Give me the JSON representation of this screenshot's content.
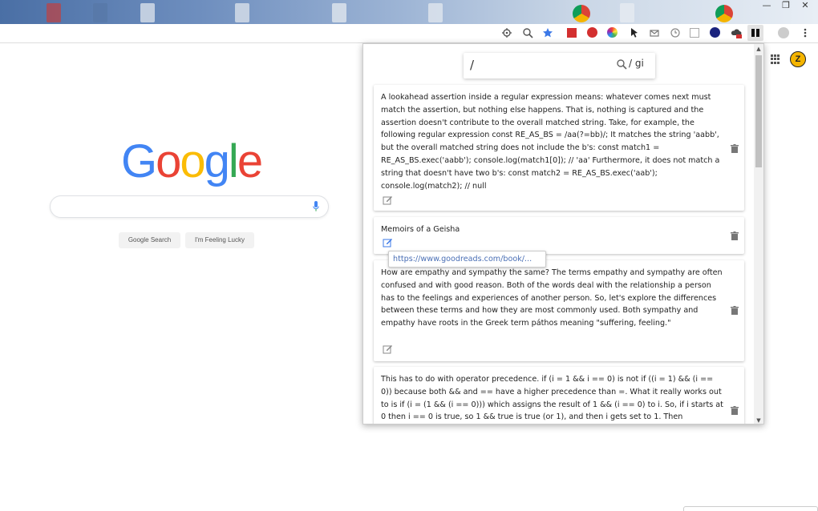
{
  "window": {
    "minimize": "—",
    "maximize": "❐",
    "close": "✕"
  },
  "google": {
    "logo_letters": [
      "G",
      "o",
      "o",
      "g",
      "l",
      "e"
    ],
    "logo_colors": [
      "#4285F4",
      "#EA4335",
      "#FBBC05",
      "#4285F4",
      "#34A853",
      "#EA4335"
    ],
    "search_button": "Google Search",
    "lucky_button": "I'm Feeling Lucky"
  },
  "popup": {
    "search_value": "/",
    "search_flags": "/ gi",
    "cards": [
      {
        "text": "A lookahead assertion inside a regular expression means: whatever comes next must match the assertion, but nothing else happens. That is, nothing is captured and the assertion doesn't contribute to the overall matched string. Take, for example, the following regular expression const RE_AS_BS = /aa(?=bb)/; It matches the string 'aabb', but the overall matched string does not include the b's: const match1 = RE_AS_BS.exec('aabb'); console.log(match1[0]); // 'aa' Furthermore, it does not match a string that doesn't have two b's: const match2 = RE_AS_BS.exec('aab'); console.log(match2); // null"
      },
      {
        "text": "Memoirs of a Geisha"
      },
      {
        "text": "How are empathy and sympathy the same? The terms empathy and sympathy are often confused and with good reason. Both of the words deal with the relationship a person has to the feelings and experiences of another person. So, let's explore the differences between these terms and how they are most commonly used. Both sympathy and empathy have roots in the Greek term páthos meaning \"suffering, feeling.\""
      },
      {
        "text": "This has to do with operator precedence. if (i = 1 && i == 0) is not if ((i = 1) && (i == 0)) because both && and == have a higher precedence than =. What it really works out to is if (i = (1 && (i == 0))) which assigns the result of 1 && (i == 0) to i. So, if i starts at 0 then i == 0 is true, so 1 && true is true (or 1), and then i gets set to 1. Then"
      }
    ],
    "tooltip_url": "https://www.goodreads.com/book/..."
  },
  "colors": {
    "link_blue": "#4a6fb5",
    "avatar_yellow": "#f4b400"
  }
}
